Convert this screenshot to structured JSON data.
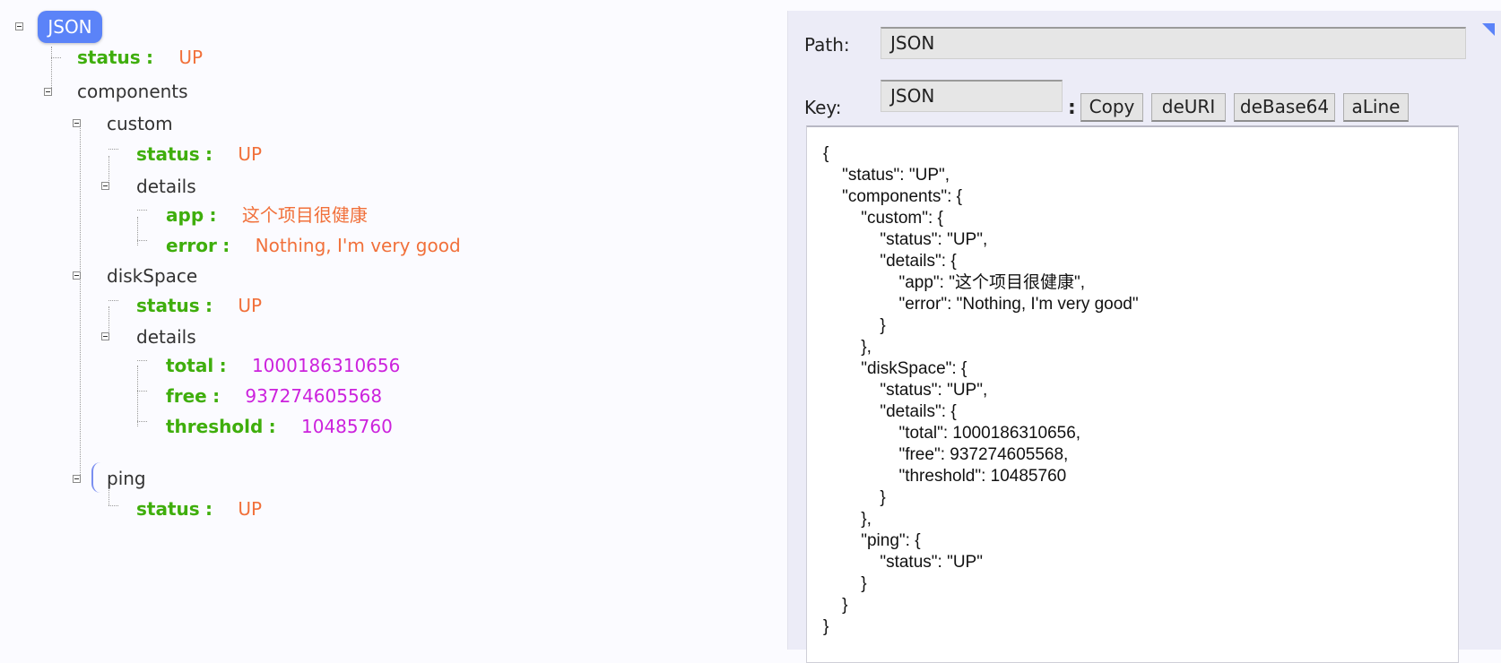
{
  "tree": {
    "root_label": "JSON",
    "separator": ":",
    "status": {
      "key": "status",
      "value": "UP"
    },
    "components": {
      "label": "components",
      "custom": {
        "label": "custom",
        "status": {
          "key": "status",
          "value": "UP"
        },
        "details": {
          "label": "details",
          "app": {
            "key": "app",
            "value": "这个项目很健康"
          },
          "error": {
            "key": "error",
            "value": "Nothing, I'm very good"
          }
        }
      },
      "diskSpace": {
        "label": "diskSpace",
        "status": {
          "key": "status",
          "value": "UP"
        },
        "details": {
          "label": "details",
          "total": {
            "key": "total",
            "value": "1000186310656"
          },
          "free": {
            "key": "free",
            "value": "937274605568"
          },
          "threshold": {
            "key": "threshold",
            "value": "10485760"
          }
        }
      },
      "ping": {
        "label": "ping",
        "status": {
          "key": "status",
          "value": "UP"
        }
      }
    }
  },
  "panel": {
    "path_label": "Path:",
    "path_value": "JSON",
    "key_label": "Key:",
    "key_value": "JSON",
    "key_colon": ":",
    "buttons": {
      "copy": "Copy",
      "deuri": "deURI",
      "debase64": "deBase64",
      "aline": "aLine"
    },
    "code": "{\n    \"status\": \"UP\",\n    \"components\": {\n        \"custom\": {\n            \"status\": \"UP\",\n            \"details\": {\n                \"app\": \"这个项目很健康\",\n                \"error\": \"Nothing, I'm very good\"\n            }\n        },\n        \"diskSpace\": {\n            \"status\": \"UP\",\n            \"details\": {\n                \"total\": 1000186310656,\n                \"free\": 937274605568,\n                \"threshold\": 10485760\n            }\n        },\n        \"ping\": {\n            \"status\": \"UP\"\n        }\n    }\n}"
  },
  "colors": {
    "key": "#3fae0c",
    "string_value": "#f1703a",
    "number_value": "#cc22dd",
    "accent": "#5b83f8"
  }
}
